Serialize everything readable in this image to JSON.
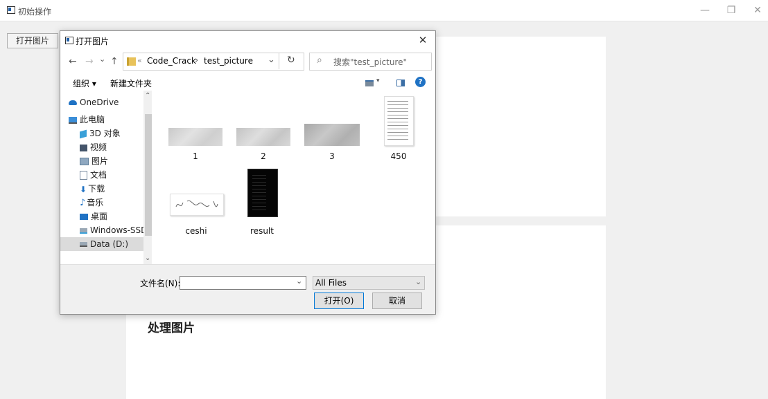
{
  "main_window": {
    "title": "初始操作",
    "open_button_label": "打开图片",
    "process_label": "处理图片",
    "minimize_glyph": "—",
    "restore_glyph": "❐",
    "close_glyph": "✕"
  },
  "dialog": {
    "title": "打开图片",
    "close_glyph": "✕",
    "nav": {
      "back": "←",
      "forward": "→",
      "recent": "⌄",
      "up": "↑"
    },
    "address": {
      "sep": "«",
      "path": [
        "Code_Crack",
        "test_picture"
      ],
      "chevron": "›",
      "dropdown": "⌄",
      "refresh": "↻"
    },
    "search": {
      "placeholder": "搜索\"test_picture\"",
      "icon": "⌕"
    },
    "toolbar": {
      "organize_label": "组织 ▾",
      "new_folder_label": "新建文件夹",
      "view_caret": "▾",
      "help_glyph": "?"
    },
    "nav_items": [
      {
        "label": "OneDrive",
        "icon": "cloud-icon"
      },
      {
        "label": "此电脑",
        "icon": "computer-icon"
      },
      {
        "label": "3D 对象",
        "icon": "cube-icon"
      },
      {
        "label": "视频",
        "icon": "video-icon"
      },
      {
        "label": "图片",
        "icon": "picture-icon"
      },
      {
        "label": "文档",
        "icon": "document-icon"
      },
      {
        "label": "下载",
        "icon": "download-icon"
      },
      {
        "label": "音乐",
        "icon": "music-icon"
      },
      {
        "label": "桌面",
        "icon": "desktop-icon"
      },
      {
        "label": "Windows-SSD (",
        "icon": "drive-icon"
      },
      {
        "label": "Data (D:)",
        "icon": "drive-icon",
        "selected": true
      }
    ],
    "scroll": {
      "up": "⌃",
      "down": "⌄"
    },
    "files": [
      {
        "name": "1"
      },
      {
        "name": "2"
      },
      {
        "name": "3"
      },
      {
        "name": "450"
      },
      {
        "name": "ceshi"
      },
      {
        "name": "result"
      }
    ],
    "filename_label": "文件名(N):",
    "filename_value": "",
    "filter_value": "All Files",
    "open_button": "打开(O)",
    "cancel_button": "取消"
  },
  "colors": {
    "accent": "#0078d7",
    "selected_bg": "#dbdbdb",
    "folder": "#e8c25a"
  }
}
